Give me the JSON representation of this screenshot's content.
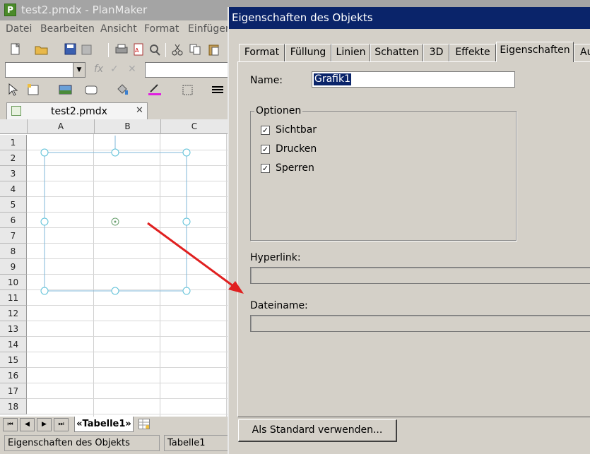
{
  "app": {
    "title": "test2.pmdx - PlanMaker",
    "icon_letter": "P",
    "menu": [
      "Datei",
      "Bearbeiten",
      "Ansicht",
      "Format",
      "Einfüger"
    ],
    "formula_fx": "fx",
    "document_tab": "test2.pmdx",
    "columns": [
      "A",
      "B",
      "C"
    ],
    "rows": [
      "1",
      "2",
      "3",
      "4",
      "5",
      "6",
      "7",
      "8",
      "9",
      "10",
      "11",
      "12",
      "13",
      "14",
      "15",
      "16",
      "17",
      "18"
    ],
    "sheet_tab": "«Tabelle1»",
    "status": {
      "left": "Eigenschaften des Objekts",
      "right": "Tabelle1"
    }
  },
  "dialog": {
    "title": "Eigenschaften des Objekts",
    "tabs": [
      "Format",
      "Füllung",
      "Linien",
      "Schatten",
      "3D",
      "Effekte",
      "Eigenschaften",
      "Au"
    ],
    "active_tab": "Eigenschaften",
    "name_label": "Name:",
    "name_value": "Grafik1",
    "options_label": "Optionen",
    "options": [
      {
        "label": "Sichtbar",
        "checked": true
      },
      {
        "label": "Drucken",
        "checked": true
      },
      {
        "label": "Sperren",
        "checked": true
      }
    ],
    "hyperlink_label": "Hyperlink:",
    "hyperlink_value": "",
    "filename_label": "Dateiname:",
    "filename_value": "",
    "default_button": "Als Standard verwenden..."
  },
  "colors": {
    "dialog_title_bg": "#0a246a",
    "selection_handle": "#7cd0e8",
    "annotation_arrow": "#e02020"
  },
  "icons": [
    "new-file-icon",
    "open-folder-icon",
    "save-icon",
    "print-icon",
    "pdf-icon",
    "cut-icon",
    "copy-icon",
    "paste-icon",
    "pointer-icon",
    "text-frame-icon",
    "picture-icon",
    "shape-icon",
    "fill-icon",
    "text-color-icon",
    "border-icon",
    "align-icon"
  ]
}
